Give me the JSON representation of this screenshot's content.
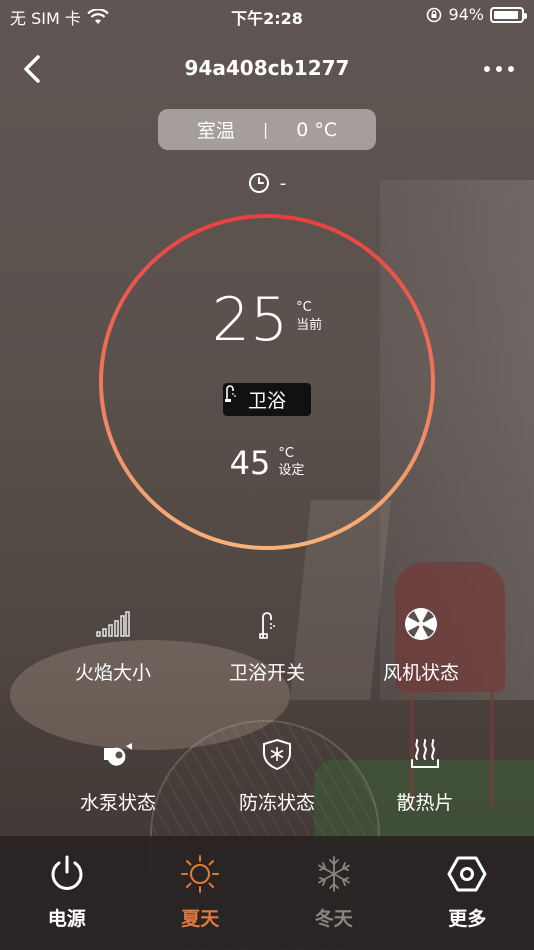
{
  "status_bar": {
    "carrier": "无 SIM 卡",
    "time": "下午2:28",
    "battery": "94%",
    "battery_level": 0.94
  },
  "header": {
    "title": "94a408cb1277"
  },
  "room_temp": {
    "label": "室温",
    "value": "0 °C"
  },
  "timer": {
    "value": "-"
  },
  "thermostat": {
    "current_value": "25",
    "current_unit": "°C",
    "current_label": "当前",
    "mode_label": "卫浴",
    "set_value": "45",
    "set_unit": "°C",
    "set_label": "设定"
  },
  "controls": [
    {
      "label": "火焰大小",
      "icon": "signal-bars-icon"
    },
    {
      "label": "卫浴开关",
      "icon": "shower-icon"
    },
    {
      "label": "风机状态",
      "icon": "fan-icon"
    },
    {
      "label": "水泵状态",
      "icon": "pump-icon"
    },
    {
      "label": "防冻状态",
      "icon": "snowflake-shield-icon"
    },
    {
      "label": "散热片",
      "icon": "radiator-icon"
    }
  ],
  "tabs": [
    {
      "label": "电源",
      "icon": "power-icon",
      "color": "#ffffff"
    },
    {
      "label": "夏天",
      "icon": "sun-icon",
      "color": "#e07a3c"
    },
    {
      "label": "冬天",
      "icon": "snowflake-icon",
      "color": "#8a8483"
    },
    {
      "label": "更多",
      "icon": "hexagon-nut-icon",
      "color": "#ffffff"
    }
  ],
  "colors": {
    "ring_start": "#e8403f",
    "ring_end": "#f7b27a",
    "active_tab": "#e07a3c",
    "inactive_tab": "#8a8483"
  }
}
